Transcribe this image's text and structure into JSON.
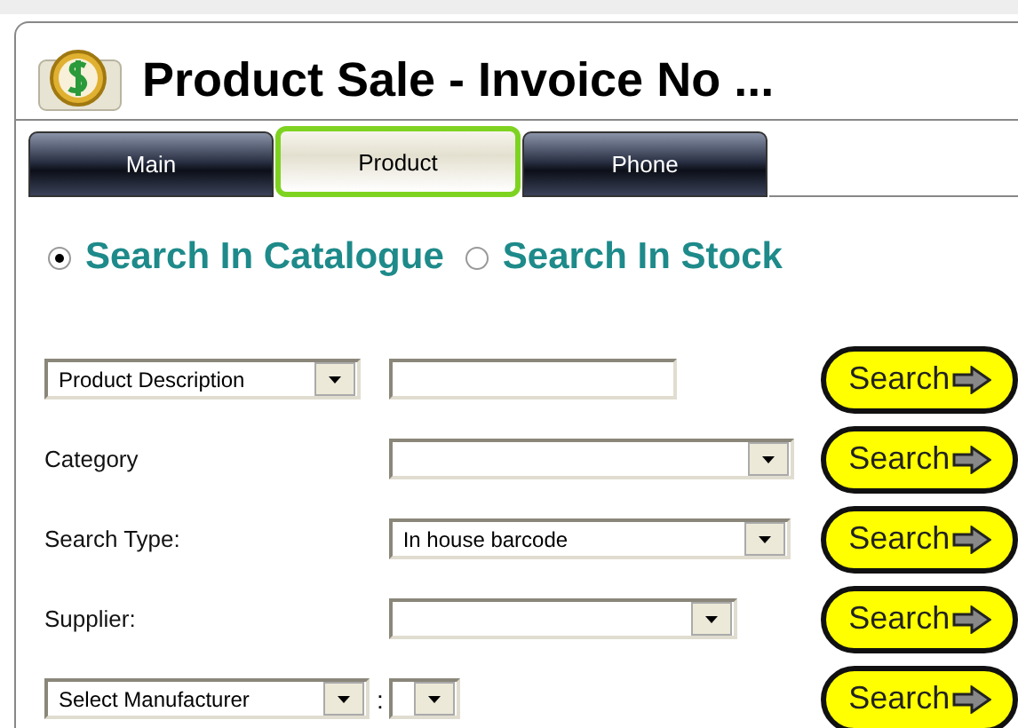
{
  "title": "Product Sale - Invoice No ...",
  "tabs": [
    {
      "label": "Main",
      "selected": false
    },
    {
      "label": "Product",
      "selected": true
    },
    {
      "label": "Phone",
      "selected": false
    }
  ],
  "search_scope": [
    {
      "label": "Search In Catalogue",
      "selected": true
    },
    {
      "label": "Search In Stock",
      "selected": false
    }
  ],
  "rows": [
    {
      "label": {
        "kind": "dropdown",
        "text": "Product Description"
      },
      "control": {
        "kind": "input"
      },
      "button": "Search"
    },
    {
      "label": {
        "kind": "text",
        "text": "Category"
      },
      "control": {
        "kind": "select"
      },
      "button": "Search"
    },
    {
      "label": {
        "kind": "text",
        "text": "Search Type:"
      },
      "control": {
        "kind": "select",
        "value": "In house barcode"
      },
      "button": "Search"
    },
    {
      "label": {
        "kind": "text",
        "text": "Supplier:"
      },
      "control": {
        "kind": "select"
      },
      "button": "Search"
    },
    {
      "label": {
        "kind": "dropdown",
        "text": "Select Manufacturer"
      },
      "separator": ":",
      "control": {
        "kind": "select"
      },
      "button": "Search"
    }
  ]
}
